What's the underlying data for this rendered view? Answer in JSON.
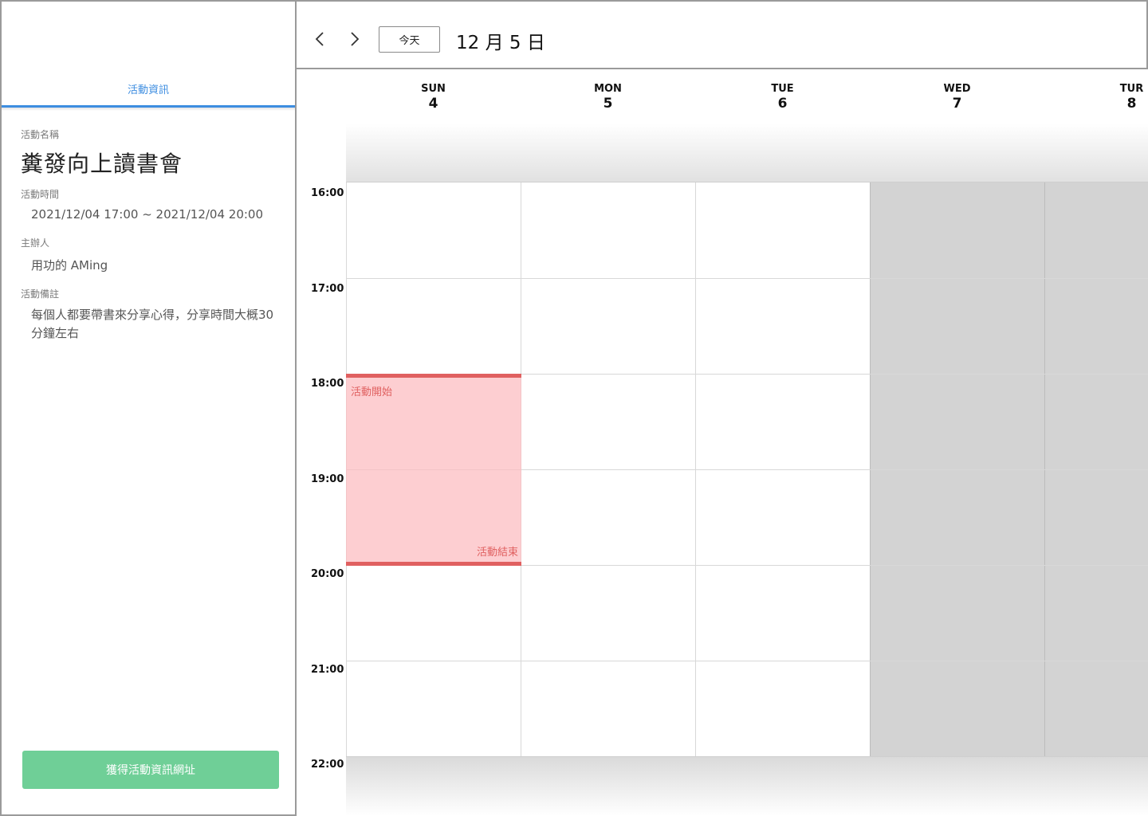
{
  "panel": {
    "tab_label": "活動資訊",
    "name_label": "活動名稱",
    "name_value": "糞發向上讀書會",
    "time_label": "活動時間",
    "time_value": "2021/12/04 17:00 ~ 2021/12/04 20:00",
    "host_label": "主辦人",
    "host_value": "用功的 AMing",
    "note_label": "活動備註",
    "note_value": "每個人都要帶書來分享心得，分享時間大概30分鐘左右",
    "share_button": "獲得活動資訊網址"
  },
  "toolbar": {
    "prev_icon": "chevron-left-icon",
    "next_icon": "chevron-right-icon",
    "today_label": "今天",
    "current_date": "12 月 5 日"
  },
  "calendar": {
    "days": [
      {
        "name": "SUN",
        "num": "4"
      },
      {
        "name": "MON",
        "num": "5"
      },
      {
        "name": "TUE",
        "num": "6"
      },
      {
        "name": "WED",
        "num": "7"
      },
      {
        "name": "TUR",
        "num": "8"
      }
    ],
    "times": [
      "16:00",
      "17:00",
      "18:00",
      "19:00",
      "20:00",
      "21:00",
      "22:00"
    ],
    "event": {
      "start_label": "活動開始",
      "end_label": "活動結束"
    },
    "colors": {
      "event_fill": "#fcbec1",
      "event_border": "#e06060",
      "disabled_day": "#d3d3d3",
      "accent": "#3d8de0",
      "share_button": "#6fcf97"
    }
  }
}
